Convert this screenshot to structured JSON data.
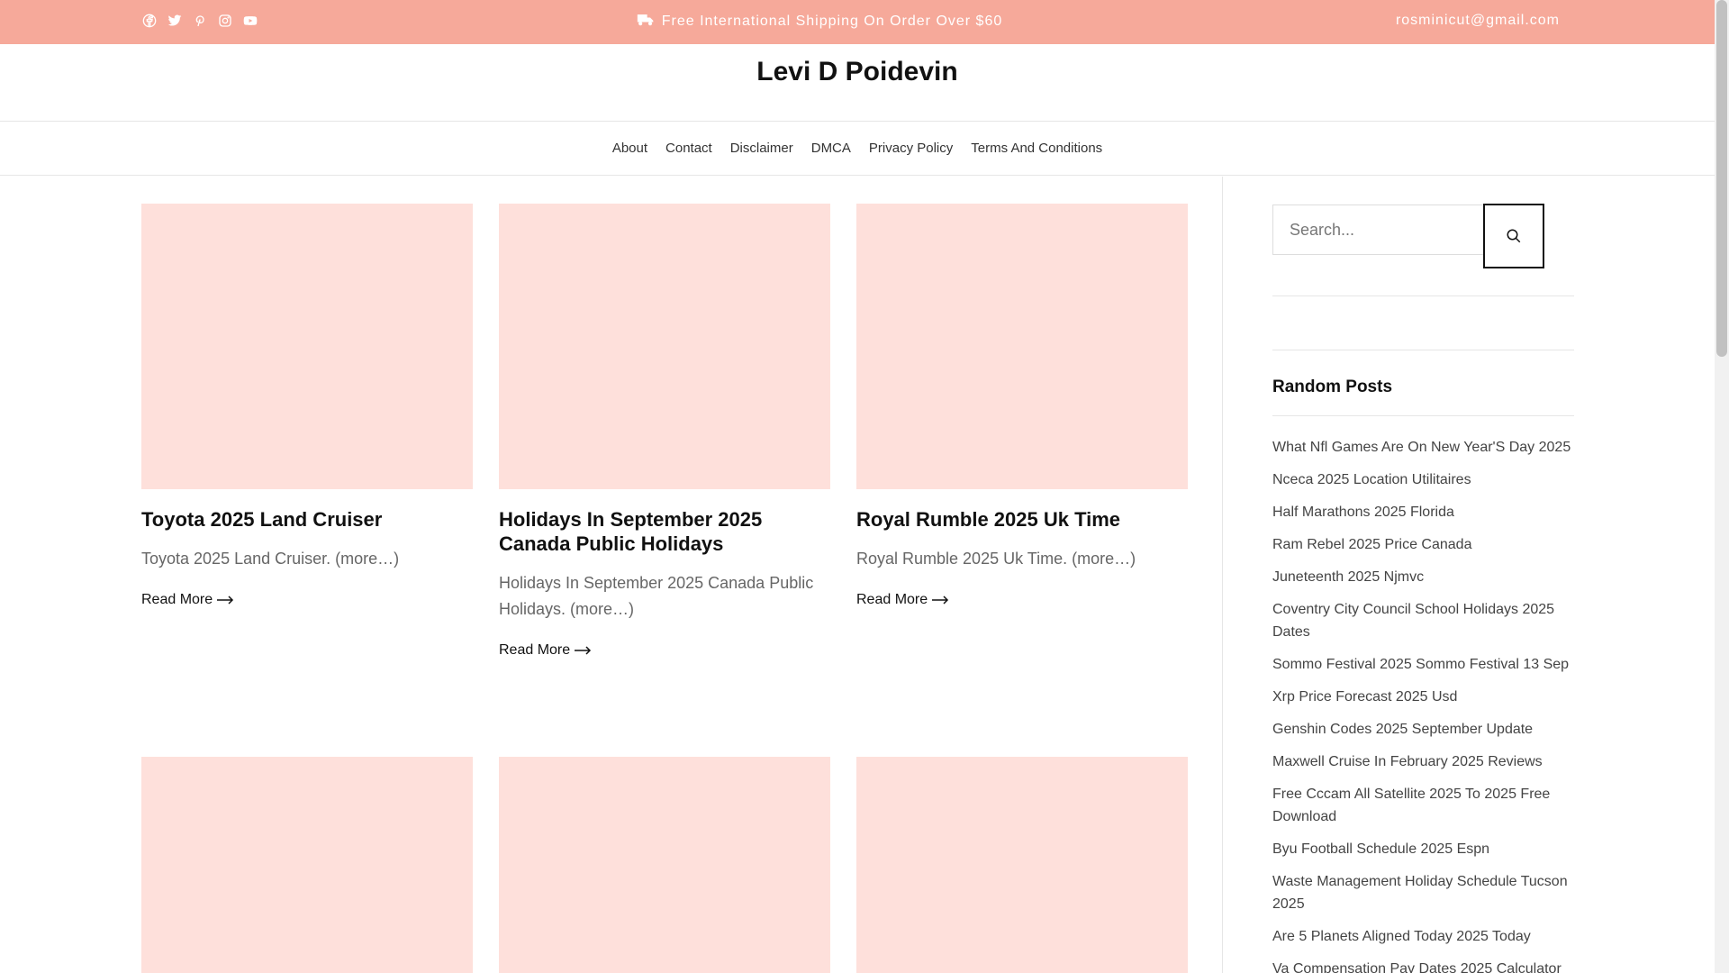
{
  "topbar": {
    "social_icons": [
      "facebook-icon",
      "twitter-icon",
      "pinterest-icon",
      "instagram-icon",
      "youtube-icon"
    ],
    "promo_icon": "truck-icon",
    "promo_text": "Free International Shipping On Order Over $60",
    "email": "rosminicut@gmail.com",
    "bg_color": "#f6a99a"
  },
  "site": {
    "title": "Levi D Poidevin"
  },
  "nav": {
    "items": [
      {
        "label": "About"
      },
      {
        "label": "Contact"
      },
      {
        "label": "Disclaimer"
      },
      {
        "label": "DMCA"
      },
      {
        "label": "Privacy Policy"
      },
      {
        "label": "Terms And Conditions"
      }
    ]
  },
  "posts": [
    {
      "title": "Toyota 2025 Land Cruiser",
      "excerpt": "Toyota 2025 Land Cruiser. (more…)",
      "read_more": "Read More"
    },
    {
      "title": "Holidays In September 2025 Canada Public Holidays",
      "excerpt": "Holidays In September 2025 Canada Public Holidays. (more…)",
      "read_more": "Read More"
    },
    {
      "title": "Royal Rumble 2025 Uk Time",
      "excerpt": "Royal Rumble 2025 Uk Time. (more…)",
      "read_more": "Read More"
    }
  ],
  "sidebar": {
    "search": {
      "placeholder": "Search...",
      "icon": "search-icon"
    },
    "random_posts": {
      "title": "Random Posts",
      "items": [
        "What Nfl Games Are On New Year'S Day 2025",
        "Nceca 2025 Location Utilitaires",
        "Half Marathons 2025 Florida",
        "Ram Rebel 2025 Price Canada",
        "Juneteenth 2025 Njmvc",
        "Coventry City Council School Holidays 2025 Dates",
        "Sommo Festival 2025 Sommo Festival 13 Sep",
        "Xrp Price Forecast 2025 Usd",
        "Genshin Codes 2025 September Update",
        "Maxwell Cruise In February 2025 Reviews",
        "Free Cccam All Satellite 2025 To 2025 Free Download",
        "Byu Football Schedule 2025 Espn",
        "Waste Management Holiday Schedule Tucson 2025",
        "Are 5 Planets Aligned Today 2025 Today",
        "Va Compensation Pay Dates 2025 Calculator"
      ]
    }
  },
  "colors": {
    "thumb_bg": "#fee0db",
    "text": "#111111",
    "muted": "#666666"
  }
}
